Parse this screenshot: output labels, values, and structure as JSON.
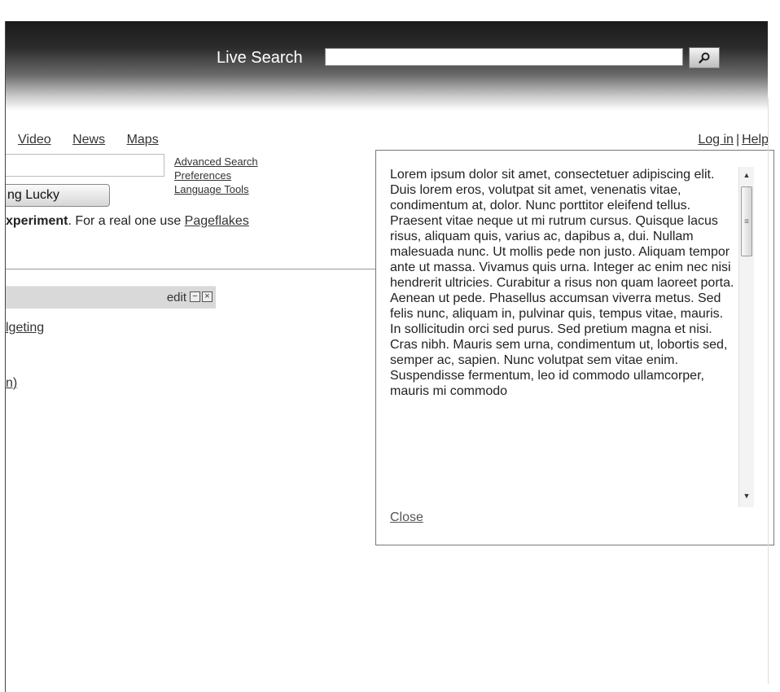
{
  "header": {
    "search_label": "Live Search",
    "search_value": "",
    "search_button_icon": "magnifier-icon"
  },
  "nav": {
    "items": [
      "Video",
      "News",
      "Maps"
    ]
  },
  "account": {
    "login": "Log in",
    "separator": "|",
    "help": "Help"
  },
  "search": {
    "value": "",
    "lucky_button": "ng Lucky",
    "links": [
      "Advanced Search",
      "Preferences",
      "Language Tools"
    ]
  },
  "notice": {
    "bold": "xperiment",
    "text": ". For a real one use ",
    "link": "Pageflakes"
  },
  "widget": {
    "edit_label": "edit",
    "minimize_icon": "minus-box-icon",
    "close_icon": "x-box-icon",
    "link_1": "lgeting",
    "link_2": "n)"
  },
  "popup": {
    "paragraph_1": "Lorem ipsum dolor sit amet, consectetuer adipiscing elit. Duis lorem eros, volutpat sit amet, venenatis vitae, condimentum at, dolor. Nunc porttitor eleifend tellus. Praesent vitae neque ut mi rutrum cursus. Quisque lacus risus, aliquam quis, varius ac, dapibus a, dui. Nullam malesuada nunc. Ut mollis pede non justo. Aliquam tempor ante ut massa. Vivamus quis urna. Integer ac enim nec nisi hendrerit ultricies. Curabitur a risus non quam laoreet porta. Aenean ut pede. Phasellus accumsan viverra metus. Sed felis nunc, aliquam in, pulvinar quis, tempus vitae, mauris. In sollicitudin orci sed purus. Sed pretium magna et nisi.",
    "paragraph_2": "Cras nibh. Mauris sem urna, condimentum ut, lobortis sed, semper ac, sapien. Nunc volutpat sem vitae enim. Suspendisse fermentum, leo id commodo ullamcorper, mauris mi commodo",
    "close_label": "Close"
  }
}
